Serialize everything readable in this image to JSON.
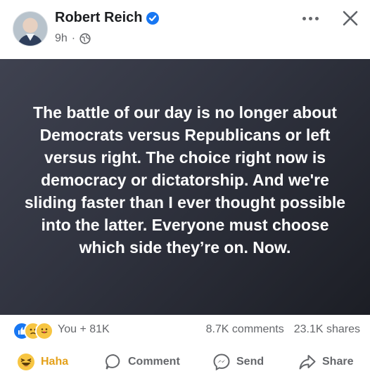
{
  "header": {
    "author_name": "Robert Reich",
    "post_time": "9h",
    "separator": "·"
  },
  "post": {
    "text": "The battle of our day is no longer about Democrats versus Republicans or left versus right. The choice right now is democracy or dictatorship. And we're sliding faster than I ever thought possible into the latter. Everyone must choose which side they’re on. Now."
  },
  "stats": {
    "reactions_text": "You + 81K",
    "comments": "8.7K comments",
    "shares": "23.1K shares"
  },
  "actions": {
    "haha_label": "Haha",
    "comment_label": "Comment",
    "send_label": "Send",
    "share_label": "Share"
  },
  "colors": {
    "brand_blue": "#1877f2",
    "text_gray": "#65676b",
    "haha_gold": "#e4a11a"
  },
  "icons": {
    "verified": "verified-badge-icon",
    "privacy": "globe-icon",
    "more": "more-dots-icon",
    "close": "close-icon",
    "comment": "comment-icon",
    "send": "messenger-icon",
    "share": "share-arrow-icon"
  }
}
